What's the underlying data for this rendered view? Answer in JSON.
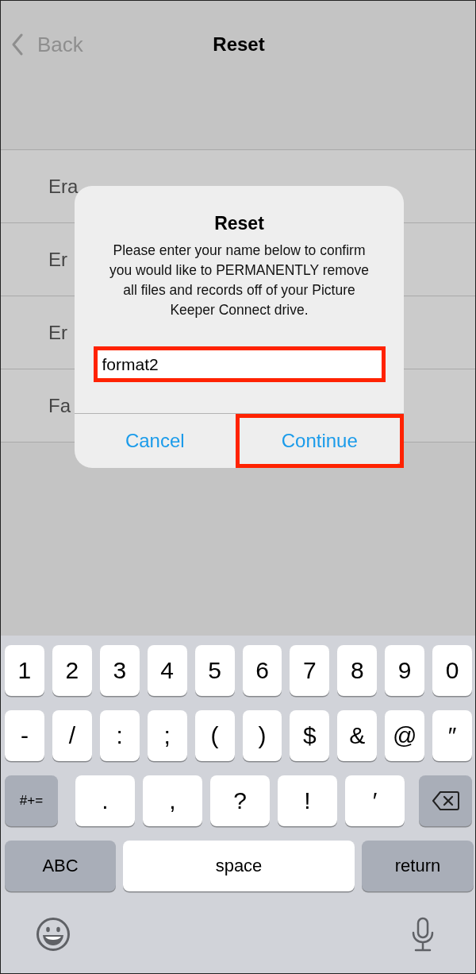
{
  "nav": {
    "back": "Back",
    "title": "Reset"
  },
  "rows": [
    "Era",
    "Er",
    "Er",
    "Fa"
  ],
  "dialog": {
    "title": "Reset",
    "message": "Please enter your name below to confirm you would like to PERMANENTLY remove all files and records off of your Picture Keeper Connect drive.",
    "field": {
      "value": "format2",
      "highlighted": true
    },
    "buttons": [
      {
        "label": "Cancel",
        "highlighted": false
      },
      {
        "label": "Continue",
        "highlighted": true
      }
    ]
  },
  "keyboard": {
    "rows": [
      {
        "keys": [
          {
            "kind": "char",
            "label": "1"
          },
          {
            "kind": "char",
            "label": "2"
          },
          {
            "kind": "char",
            "label": "3"
          },
          {
            "kind": "char",
            "label": "4"
          },
          {
            "kind": "char",
            "label": "5"
          },
          {
            "kind": "char",
            "label": "6"
          },
          {
            "kind": "char",
            "label": "7"
          },
          {
            "kind": "char",
            "label": "8"
          },
          {
            "kind": "char",
            "label": "9"
          },
          {
            "kind": "char",
            "label": "0"
          }
        ]
      },
      {
        "keys": [
          {
            "kind": "char",
            "label": "-"
          },
          {
            "kind": "char",
            "label": "/"
          },
          {
            "kind": "char",
            "label": ":"
          },
          {
            "kind": "char",
            "label": ";"
          },
          {
            "kind": "char",
            "label": "("
          },
          {
            "kind": "char",
            "label": ")"
          },
          {
            "kind": "char",
            "label": "$"
          },
          {
            "kind": "char",
            "label": "&"
          },
          {
            "kind": "char",
            "label": "@"
          },
          {
            "kind": "char",
            "label": "″"
          }
        ]
      },
      {
        "keys": [
          {
            "kind": "function",
            "label": "#+="
          },
          {
            "kind": "char",
            "label": "."
          },
          {
            "kind": "char",
            "label": ","
          },
          {
            "kind": "char",
            "label": "?"
          },
          {
            "kind": "char",
            "label": "!"
          },
          {
            "kind": "char",
            "label": "′"
          },
          {
            "kind": "delete"
          }
        ]
      },
      {
        "keys": [
          {
            "kind": "function",
            "label": "ABC"
          },
          {
            "kind": "space",
            "label": "space"
          },
          {
            "kind": "function",
            "label": "return"
          }
        ]
      }
    ]
  }
}
